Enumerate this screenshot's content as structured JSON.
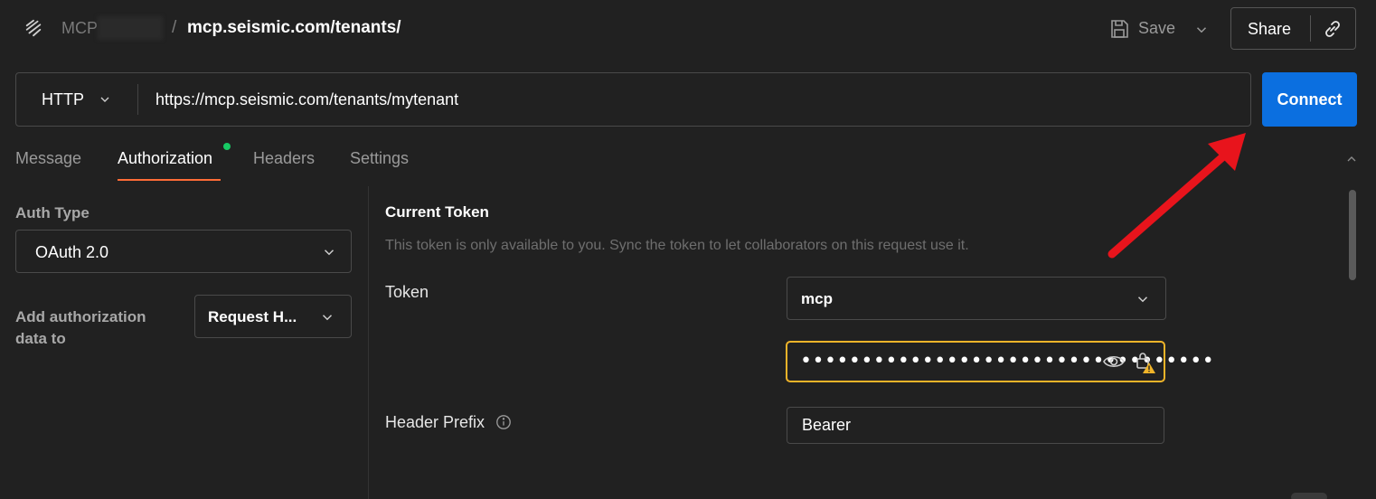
{
  "header": {
    "collection_prefix": "MCP",
    "separator": "/",
    "request_title": "mcp.seismic.com/tenants/",
    "save_label": "Save",
    "share_label": "Share"
  },
  "request": {
    "method": "HTTP",
    "url": "https://mcp.seismic.com/tenants/mytenant",
    "connect_label": "Connect"
  },
  "tabs": [
    {
      "label": "Message",
      "active": false
    },
    {
      "label": "Authorization",
      "active": true
    },
    {
      "label": "Headers",
      "active": false
    },
    {
      "label": "Settings",
      "active": false
    }
  ],
  "auth": {
    "type_label": "Auth Type",
    "type_value": "OAuth 2.0",
    "add_to_label": "Add authorization data to",
    "add_to_value": "Request H..."
  },
  "token_section": {
    "title": "Current Token",
    "description": "This token is only available to you. Sync the token to let collaborators on this request use it.",
    "token_label": "Token",
    "token_name": "mcp",
    "token_masked": "••••••••••••••••••••••••••••••••••",
    "header_prefix_label": "Header Prefix",
    "header_prefix_value": "Bearer"
  },
  "colors": {
    "background": "#212121",
    "accent_blue": "#0b6fe0",
    "tab_underline": "#ff6c37",
    "warning": "#f0b429",
    "status_dot": "#17c964",
    "annotation_arrow": "#e8141c"
  },
  "icons": [
    "logo-icon",
    "save-icon",
    "chevron-down-icon",
    "link-icon",
    "eye-icon",
    "lock-warning-icon",
    "info-icon",
    "chevron-up-icon"
  ]
}
